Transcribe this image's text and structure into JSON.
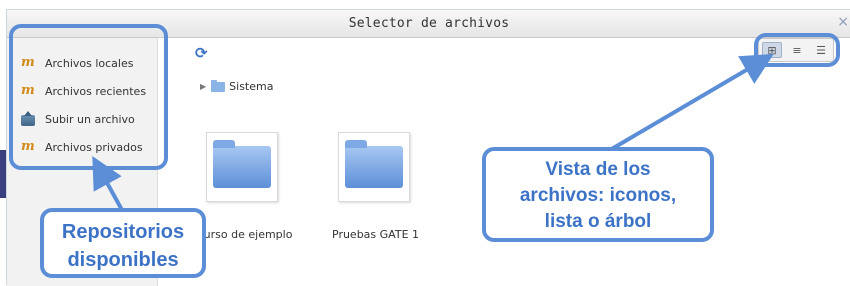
{
  "window": {
    "title": "Selector de archivos",
    "close_glyph": "×"
  },
  "sidebar": {
    "items": [
      {
        "label": "Archivos locales",
        "icon": "moodle-icon"
      },
      {
        "label": "Archivos recientes",
        "icon": "moodle-icon"
      },
      {
        "label": "Subir un archivo",
        "icon": "upload-icon"
      },
      {
        "label": "Archivos privados",
        "icon": "moodle-icon"
      }
    ]
  },
  "toolbar": {
    "refresh_glyph": "⟳"
  },
  "breadcrumb": {
    "folder": "Sistema"
  },
  "view_modes": {
    "icons_glyph": "⊞",
    "list_glyph": "≡",
    "tree_glyph": "☰"
  },
  "files": [
    {
      "name": "Curso de ejemplo"
    },
    {
      "name": "Pruebas GATE 1"
    }
  ],
  "annotations": {
    "repos_line1": "Repositorios",
    "repos_line2": "disponibles",
    "views_line1": "Vista de los",
    "views_line2": "archivos: iconos,",
    "views_line3": "lista o árbol"
  },
  "colors": {
    "callout_blue": "#5b8ed6",
    "callout_text": "#3d73c6",
    "folder_blue": "#6f9ee0"
  }
}
